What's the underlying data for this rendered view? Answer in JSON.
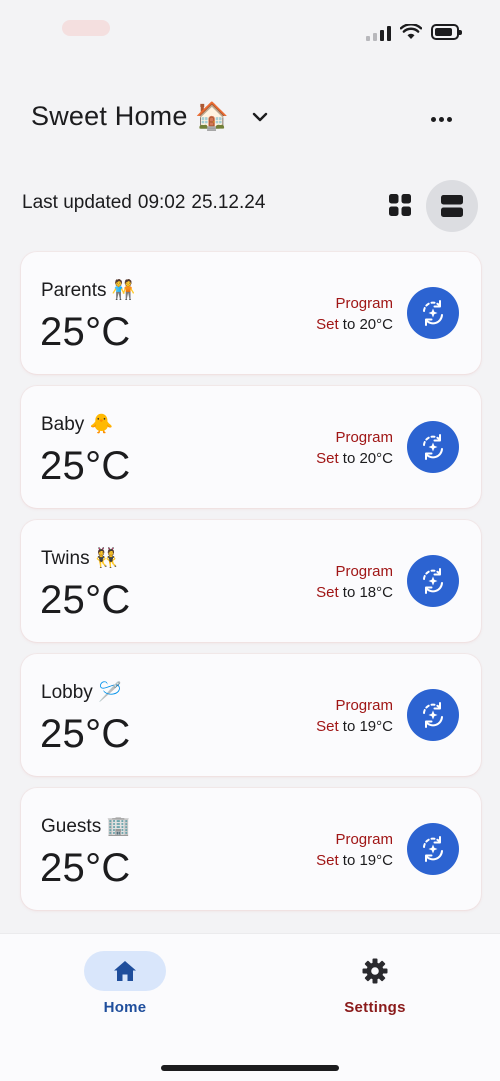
{
  "header": {
    "home_name": "Sweet Home",
    "home_emoji": "🏠"
  },
  "status": {
    "last_updated": "Last updated",
    "time": "09:02",
    "date": "25.12.24"
  },
  "rooms": [
    {
      "name": "Parents",
      "emoji": "🧑‍🤝‍🧑",
      "temperature": "25°C",
      "program": "Program",
      "set_word": "Set",
      "set_rest": " to 20°C"
    },
    {
      "name": "Baby",
      "emoji": "🐥",
      "temperature": "25°C",
      "program": "Program",
      "set_word": "Set",
      "set_rest": " to 20°C"
    },
    {
      "name": "Twins",
      "emoji": "👯",
      "temperature": "25°C",
      "program": "Program",
      "set_word": "Set",
      "set_rest": " to 18°C"
    },
    {
      "name": "Lobby",
      "emoji": "🪡",
      "temperature": "25°C",
      "program": "Program",
      "set_word": "Set",
      "set_rest": " to 19°C"
    },
    {
      "name": "Guests",
      "emoji": "🏢",
      "temperature": "25°C",
      "program": "Program",
      "set_word": "Set",
      "set_rest": " to 19°C"
    }
  ],
  "nav": {
    "home": "Home",
    "settings": "Settings"
  },
  "icons": {
    "program": "autorenew-sparkle-icon",
    "home": "home-icon",
    "settings": "gear-icon",
    "grid_view": "grid-view-icon",
    "list_view": "list-view-icon"
  },
  "colors": {
    "accent_blue": "#2c63d1",
    "program_red": "#a01616",
    "nav_home": "#1f4e9c",
    "nav_home_pill": "#d9e6fb"
  }
}
